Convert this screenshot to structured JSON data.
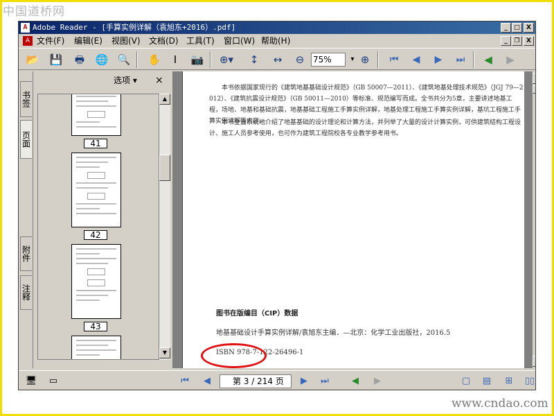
{
  "watermark": {
    "top": "中国道桥网",
    "bottom": "www.cndao.com"
  },
  "window": {
    "title": "Adobe Reader - [手算实例详解（袁旭东+2016）.pdf]",
    "buttons": {
      "minimize": "_",
      "restore": "□",
      "close": "X"
    },
    "doc_buttons": {
      "minimize": "_",
      "restore": "❐",
      "close": "X"
    }
  },
  "menu": [
    {
      "label": "文件(F)"
    },
    {
      "label": "编辑(E)"
    },
    {
      "label": "视图(V)"
    },
    {
      "label": "文档(D)"
    },
    {
      "label": "工具(T)"
    },
    {
      "label": "窗口(W)"
    },
    {
      "label": "帮助(H)"
    }
  ],
  "toolbar": {
    "zoom_value": "75%",
    "icons": [
      "open-icon",
      "save-icon",
      "print-icon",
      "email-icon",
      "search-icon",
      "hand-icon",
      "select-text-icon",
      "snapshot-icon",
      "zoom-in-icon",
      "fit-height-icon",
      "fit-width-icon",
      "zoom-out-icon",
      "zoom-add-icon",
      "first-page-icon",
      "previous-page-icon",
      "next-page-icon",
      "last-page-icon",
      "go-back-icon",
      "go-forward-icon"
    ]
  },
  "left_tabs": {
    "bookmarks": "书签",
    "pages": "页面",
    "attachments": "附件",
    "comments": "注释"
  },
  "panel": {
    "options_label": "选项 ▾",
    "close": "×",
    "pages": [
      "41",
      "42",
      "43"
    ]
  },
  "document": {
    "paragraph1": "本书依据国家现行的《建筑地基基础设计规范》（GB 50007—2011）、《建筑地基处理技术规范》（JGJ 79—2012）、《建筑抗震设计规范》（GB 50011—2010）等标准、规范编写而成。全书共分为5章，主要讲述地基工程，场地、地基和基础抗震，地基基础工程施工手算实例详解，地基处理工程施工手算实例详解，基坑工程施工手算实例详解等内容。",
    "paragraph2": "本书全面系统地介绍了地基基础的设计理论和计算方法，并列举了大量的设计计算实例，可供建筑结构工程设计、施工人员参考使用，也可作为建筑工程院校各专业教学参考用书。",
    "cip_title": "图书在版编目（CIP）数据",
    "cip_text": "地基基础设计手算实例详解/袁旭东主编．—北京：化学工业出版社，2016.5",
    "isbn": "ISBN 978-7-122-26496-1"
  },
  "status": {
    "page_display": "第 3 / 214 页"
  },
  "colors": {
    "title_bar": "#0a246a",
    "highlight": "#e01010",
    "frame": "#f2dd00"
  }
}
